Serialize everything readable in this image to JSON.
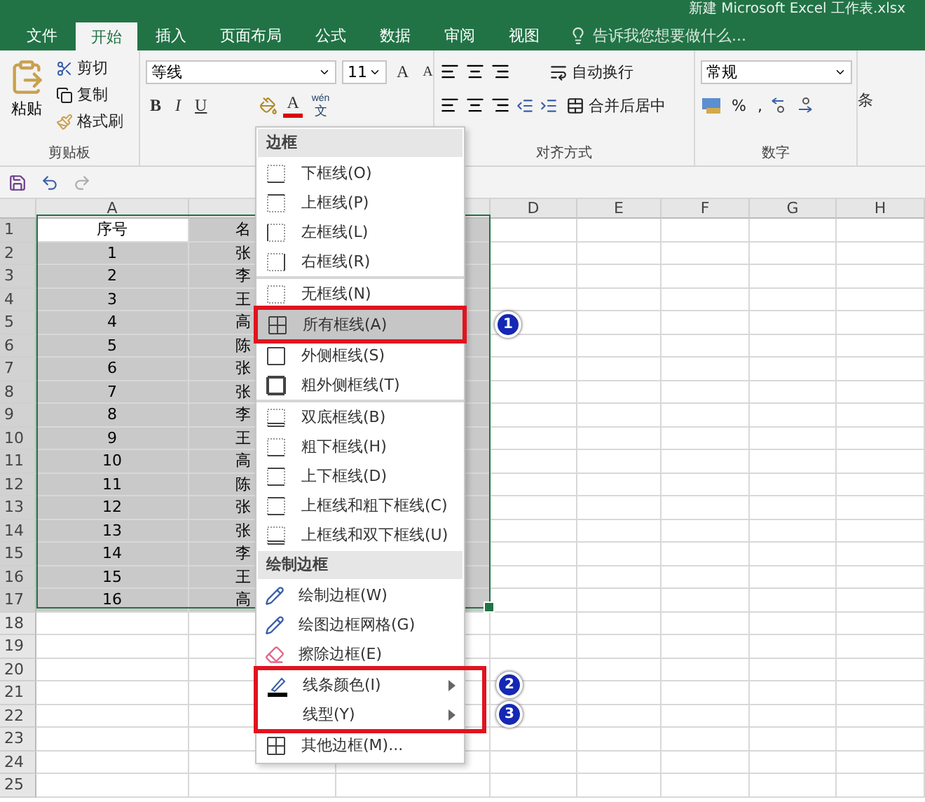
{
  "window": {
    "title": "新建 Microsoft Excel 工作表.xlsx"
  },
  "tabs": [
    {
      "label": "文件",
      "selected": false
    },
    {
      "label": "开始",
      "selected": true
    },
    {
      "label": "插入",
      "selected": false
    },
    {
      "label": "页面布局",
      "selected": false
    },
    {
      "label": "公式",
      "selected": false
    },
    {
      "label": "数据",
      "selected": false
    },
    {
      "label": "审阅",
      "selected": false
    },
    {
      "label": "视图",
      "selected": false
    }
  ],
  "tell_me": {
    "placeholder": "告诉我您想要做什么..."
  },
  "ribbon": {
    "clipboard": {
      "paste": "粘贴",
      "cut": "剪切",
      "copy": "复制",
      "format_painter": "格式刷",
      "label": "剪贴板"
    },
    "font": {
      "name": "等线",
      "size": "11",
      "grow": "A",
      "shrink": "A",
      "bold": "B",
      "italic": "I",
      "underline": "U",
      "font_color": "A",
      "phonetic_top": "wén",
      "phonetic_bottom": "文"
    },
    "alignment": {
      "wrap": "自动换行",
      "merge": "合并后居中",
      "label": "对齐方式"
    },
    "number": {
      "format": "常规",
      "percent": "%",
      "comma": ",",
      "label": "数字"
    },
    "next_group_cut": "条"
  },
  "sheet": {
    "columns": [
      {
        "label": "A"
      },
      {},
      {},
      {
        "label": "D"
      },
      {
        "label": "E"
      },
      {
        "label": "F"
      },
      {
        "label": "G"
      },
      {
        "label": "H"
      }
    ],
    "rows": [
      {
        "header": "1",
        "a": "序号",
        "b": "名",
        "selected": true,
        "active": true
      },
      {
        "header": "2",
        "a": "1",
        "b": "张",
        "selected": true,
        "active": false
      },
      {
        "header": "3",
        "a": "2",
        "b": "李",
        "selected": true,
        "active": false
      },
      {
        "header": "4",
        "a": "3",
        "b": "王",
        "selected": true,
        "active": false
      },
      {
        "header": "5",
        "a": "4",
        "b": "高",
        "selected": true,
        "active": false
      },
      {
        "header": "6",
        "a": "5",
        "b": "陈",
        "selected": true,
        "active": false
      },
      {
        "header": "7",
        "a": "6",
        "b": "张",
        "selected": true,
        "active": false
      },
      {
        "header": "8",
        "a": "7",
        "b": "张",
        "selected": true,
        "active": false
      },
      {
        "header": "9",
        "a": "8",
        "b": "李",
        "selected": true,
        "active": false
      },
      {
        "header": "10",
        "a": "9",
        "b": "王",
        "selected": true,
        "active": false
      },
      {
        "header": "11",
        "a": "10",
        "b": "高",
        "selected": true,
        "active": false
      },
      {
        "header": "12",
        "a": "11",
        "b": "陈",
        "selected": true,
        "active": false
      },
      {
        "header": "13",
        "a": "12",
        "b": "张",
        "selected": true,
        "active": false
      },
      {
        "header": "14",
        "a": "13",
        "b": "张",
        "selected": true,
        "active": false
      },
      {
        "header": "15",
        "a": "14",
        "b": "李",
        "selected": true,
        "active": false
      },
      {
        "header": "16",
        "a": "15",
        "b": "王",
        "selected": true,
        "active": false
      },
      {
        "header": "17",
        "a": "16",
        "b": "高",
        "selected": true,
        "active": false
      },
      {
        "header": "18",
        "selected": false,
        "active": false
      },
      {
        "header": "19",
        "selected": false,
        "active": false
      },
      {
        "header": "20",
        "selected": false,
        "active": false
      },
      {
        "header": "21",
        "selected": false,
        "active": false
      },
      {
        "header": "22",
        "selected": false,
        "active": false
      },
      {
        "header": "23",
        "selected": false,
        "active": false
      },
      {
        "header": "24",
        "selected": false,
        "active": false
      },
      {
        "header": "25",
        "selected": false,
        "active": false
      }
    ]
  },
  "border_menu": {
    "sections": [
      {
        "title": "边框",
        "items": [
          {
            "label": "下框线(O)",
            "kind": "bottom",
            "highlighted": false,
            "separator_after": false
          },
          {
            "label": "上框线(P)",
            "kind": "top",
            "highlighted": false,
            "separator_after": false
          },
          {
            "label": "左框线(L)",
            "kind": "left",
            "highlighted": false,
            "separator_after": false
          },
          {
            "label": "右框线(R)",
            "kind": "right",
            "highlighted": false,
            "separator_after": true
          },
          {
            "label": "无框线(N)",
            "kind": "none",
            "highlighted": false,
            "separator_after": false
          },
          {
            "label": "所有框线(A)",
            "kind": "all",
            "highlighted": true,
            "separator_after": false,
            "callout": "1"
          },
          {
            "label": "外侧框线(S)",
            "kind": "outside",
            "highlighted": false,
            "separator_after": false
          },
          {
            "label": "粗外侧框线(T)",
            "kind": "thick",
            "highlighted": false,
            "separator_after": true
          },
          {
            "label": "双底框线(B)",
            "kind": "double",
            "highlighted": false,
            "separator_after": false
          },
          {
            "label": "粗下框线(H)",
            "kind": "bottom",
            "highlighted": false,
            "separator_after": false
          },
          {
            "label": "上下框线(D)",
            "kind": "topbottom",
            "highlighted": false,
            "separator_after": false
          },
          {
            "label": "上框线和粗下框线(C)",
            "kind": "topbottom",
            "highlighted": false,
            "separator_after": false
          },
          {
            "label": "上框线和双下框线(U)",
            "kind": "double",
            "highlighted": false,
            "separator_after": false
          }
        ]
      },
      {
        "title": "绘制边框",
        "items": [
          {
            "label": "绘制边框(W)",
            "kind": "pen",
            "highlighted": false,
            "separator_after": false
          },
          {
            "label": "绘图边框网格(G)",
            "kind": "gridpen",
            "highlighted": false,
            "separator_after": false
          },
          {
            "label": "擦除边框(E)",
            "kind": "eraser",
            "highlighted": false,
            "separator_after": false
          },
          {
            "label": "线条颜色(I)",
            "kind": "color",
            "highlighted": false,
            "submenu": true,
            "separator_after": false,
            "callout": "2"
          },
          {
            "label": "线型(Y)",
            "kind": "blank",
            "highlighted": false,
            "submenu": true,
            "separator_after": false,
            "callout": "3"
          },
          {
            "label": "其他边框(M)...",
            "kind": "all",
            "highlighted": false,
            "separator_after": false
          }
        ]
      }
    ]
  }
}
